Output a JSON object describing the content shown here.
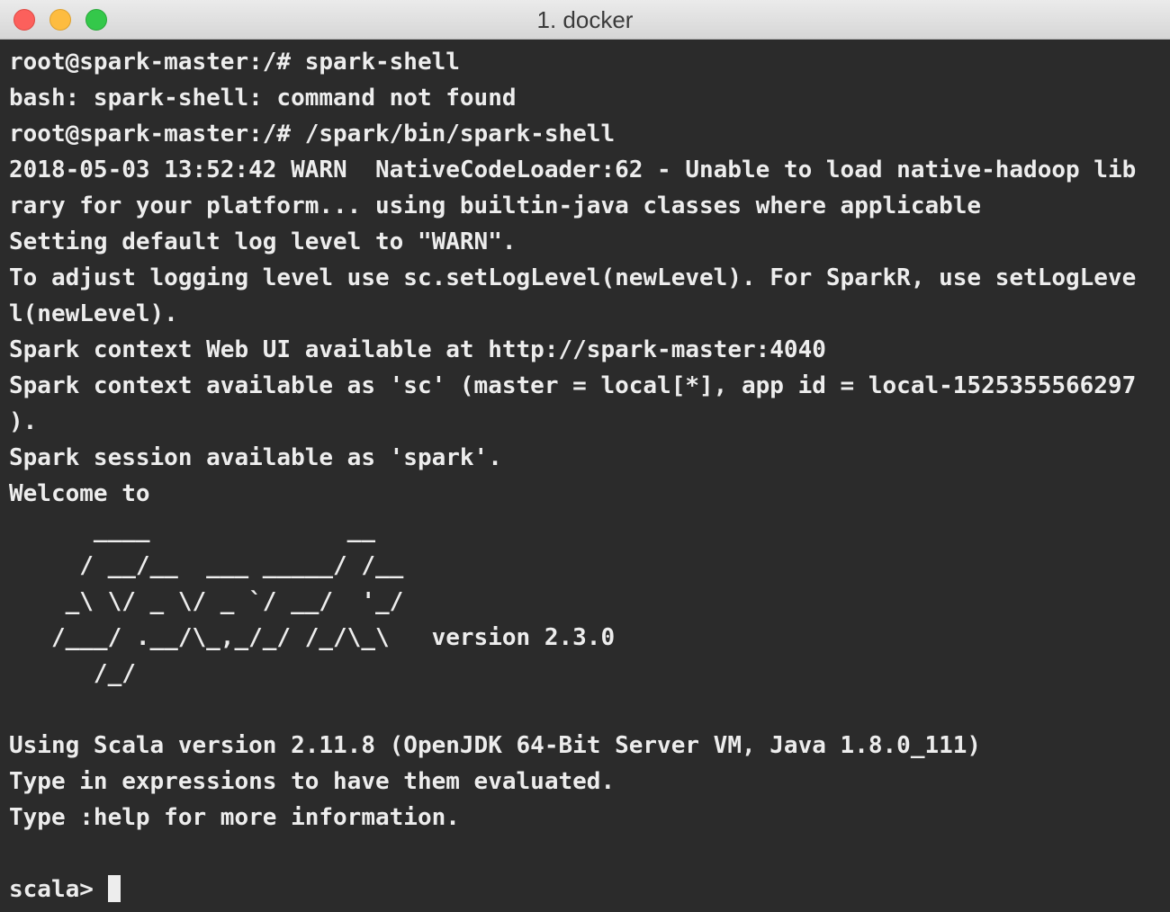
{
  "window": {
    "title": "1. docker",
    "buttons": {
      "close": "close-button",
      "minimize": "minimize-button",
      "zoom": "zoom-button"
    }
  },
  "terminal": {
    "background_color": "#2b2b2b",
    "text_color": "#ededed",
    "lines": [
      "root@spark-master:/# spark-shell",
      "bash: spark-shell: command not found",
      "root@spark-master:/# /spark/bin/spark-shell",
      "2018-05-03 13:52:42 WARN  NativeCodeLoader:62 - Unable to load native-hadoop lib",
      "rary for your platform... using builtin-java classes where applicable",
      "Setting default log level to \"WARN\".",
      "To adjust logging level use sc.setLogLevel(newLevel). For SparkR, use setLogLeve",
      "l(newLevel).",
      "Spark context Web UI available at http://spark-master:4040",
      "Spark context available as 'sc' (master = local[*], app id = local-1525355566297",
      ").",
      "Spark session available as 'spark'.",
      "Welcome to",
      "      ____              __",
      "     / __/__  ___ _____/ /__",
      "    _\\ \\/ _ \\/ _ `/ __/  '_/",
      "   /___/ .__/\\_,_/_/ /_/\\_\\   version 2.3.0",
      "      /_/",
      "",
      "Using Scala version 2.11.8 (OpenJDK 64-Bit Server VM, Java 1.8.0_111)",
      "Type in expressions to have them evaluated.",
      "Type :help for more information.",
      "",
      "scala> "
    ]
  }
}
